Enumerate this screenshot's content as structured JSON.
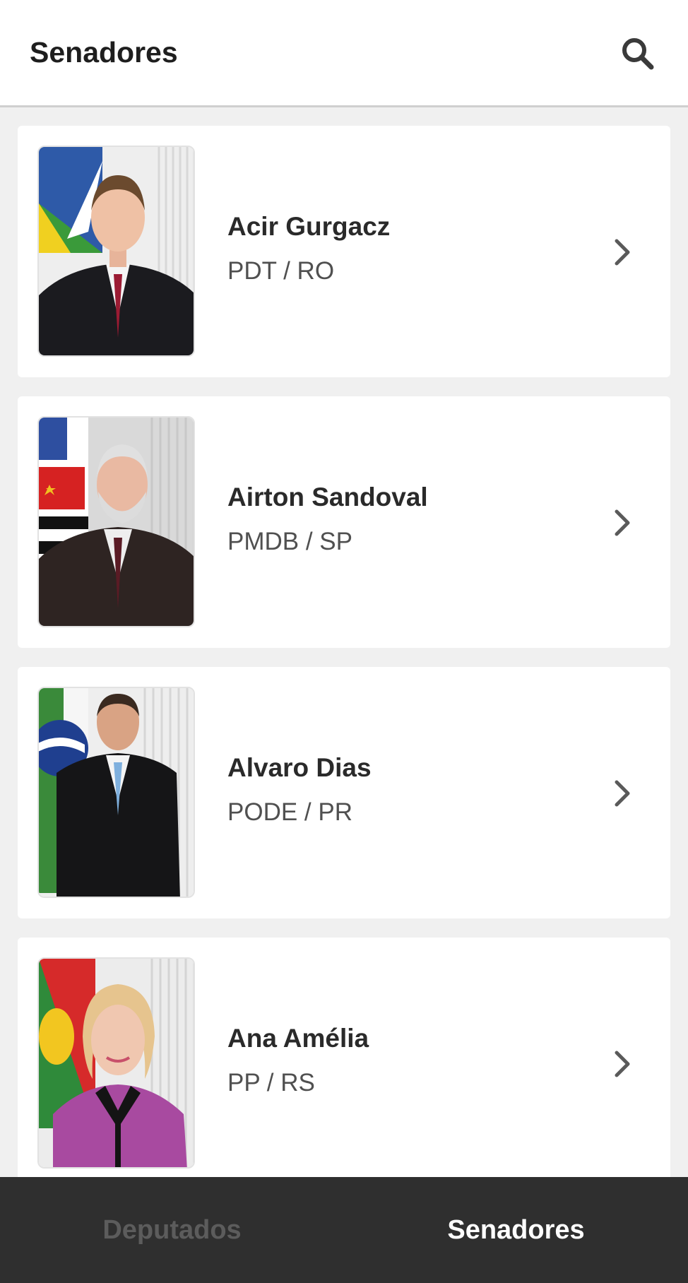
{
  "header": {
    "title": "Senadores",
    "search_icon": "search-icon"
  },
  "senators": [
    {
      "name": "Acir Gurgacz",
      "party": "PDT / RO"
    },
    {
      "name": "Airton Sandoval",
      "party": "PMDB / SP"
    },
    {
      "name": "Alvaro Dias",
      "party": "PODE / PR"
    },
    {
      "name": "Ana Amélia",
      "party": "PP / RS"
    }
  ],
  "bottom_nav": {
    "tabs": [
      {
        "label": "Deputados",
        "active": false
      },
      {
        "label": "Senadores",
        "active": true
      }
    ]
  },
  "colors": {
    "background": "#f0f0f0",
    "card": "#ffffff",
    "nav_background": "#2f2f2f",
    "nav_active": "#ffffff",
    "nav_inactive": "#5c5c5c"
  }
}
